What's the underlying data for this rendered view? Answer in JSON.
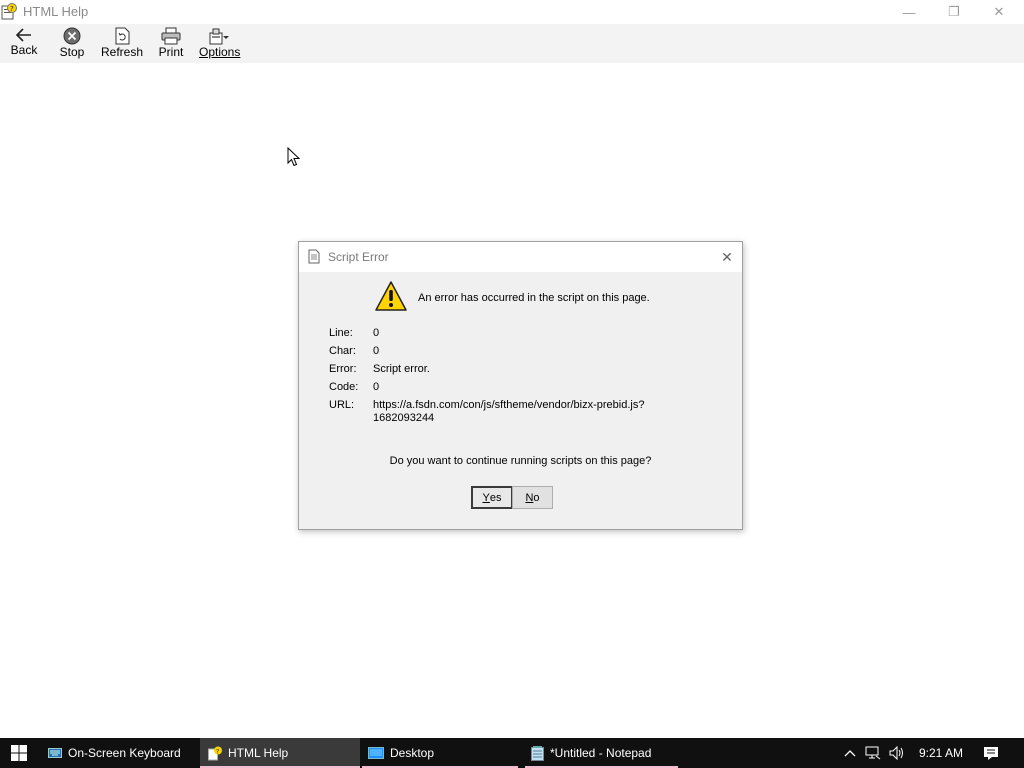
{
  "window": {
    "title": "HTML Help",
    "minimize": "—",
    "maximize": "❐",
    "close": "✕"
  },
  "toolbar": {
    "back_label": "Back",
    "stop_label": "Stop",
    "refresh_label": "Refresh",
    "print_label": "Print",
    "options_label": "Options"
  },
  "dialog": {
    "title": "Script Error",
    "close": "✕",
    "message": "An error has occurred in the script on this page.",
    "fields": {
      "line_key": "Line:",
      "line_value": "0",
      "char_key": "Char:",
      "char_value": "0",
      "error_key": "Error:",
      "error_value": "Script error.",
      "code_key": "Code:",
      "code_value": "0",
      "url_key": "URL:",
      "url_value": "https://a.fsdn.com/con/js/sftheme/vendor/bizx-prebid.js? 1682093244"
    },
    "question": "Do you want to continue running scripts on this page?",
    "yes_rest": "es",
    "yes_accel": "Y",
    "no_rest": "o",
    "no_accel": "N"
  },
  "taskbar": {
    "items": [
      {
        "label": "On-Screen Keyboard",
        "icon": "keyboard-icon"
      },
      {
        "label": "HTML Help",
        "icon": "help-icon",
        "active": true
      },
      {
        "label": "Desktop",
        "icon": "folder-icon"
      },
      {
        "label": "*Untitled - Notepad",
        "icon": "notepad-icon"
      }
    ],
    "clock": "9:21 AM"
  },
  "colors": {
    "taskbar_bg": "#101010",
    "taskbar_active": "#3a3a3a",
    "taskbar_underline": "#f4bcd0",
    "dialog_bg": "#f0f0f0"
  }
}
